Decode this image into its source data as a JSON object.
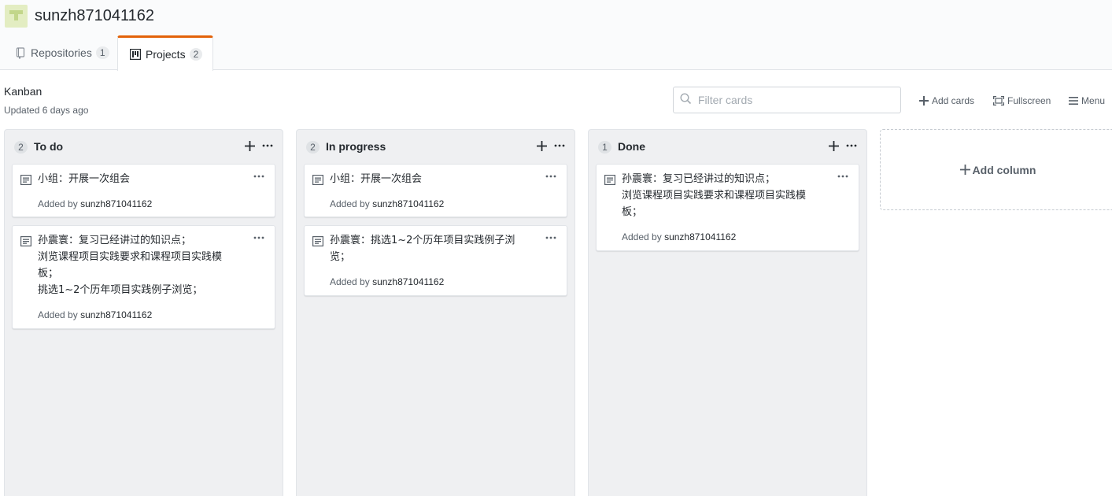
{
  "owner": {
    "name": "sunzh871041162"
  },
  "tabs": [
    {
      "label": "Repositories",
      "count": "1"
    },
    {
      "label": "Projects",
      "count": "2"
    }
  ],
  "board": {
    "name": "Kanban",
    "updated": "Updated 6 days ago"
  },
  "toolbar": {
    "filter_placeholder": "Filter cards",
    "add_cards": "Add cards",
    "fullscreen": "Fullscreen",
    "menu": "Menu"
  },
  "columns": [
    {
      "title": "To do",
      "count": "2",
      "cards": [
        {
          "text": "小组：开展一次组会",
          "added_prefix": "Added by",
          "author": "sunzh871041162"
        },
        {
          "text": "孙震寰：复习已经讲过的知识点；\n浏览课程项目实践要求和课程项目实践模\n板；\n挑选1~2个历年项目实践例子浏览；",
          "added_prefix": "Added by",
          "author": "sunzh871041162"
        }
      ]
    },
    {
      "title": "In progress",
      "count": "2",
      "cards": [
        {
          "text": "小组：开展一次组会",
          "added_prefix": "Added by",
          "author": "sunzh871041162"
        },
        {
          "text": "孙震寰：挑选1~2个历年项目实践例子浏\n览；",
          "added_prefix": "Added by",
          "author": "sunzh871041162"
        }
      ]
    },
    {
      "title": "Done",
      "count": "1",
      "cards": [
        {
          "text": "孙震寰：复习已经讲过的知识点；\n浏览课程项目实践要求和课程项目实践模\n板；",
          "added_prefix": "Added by",
          "author": "sunzh871041162"
        }
      ]
    }
  ],
  "add_column": {
    "label": "Add column"
  },
  "colors": {
    "accent_tab": "#e36209",
    "column_bg": "#eff0f2",
    "muted_text": "#586069"
  }
}
